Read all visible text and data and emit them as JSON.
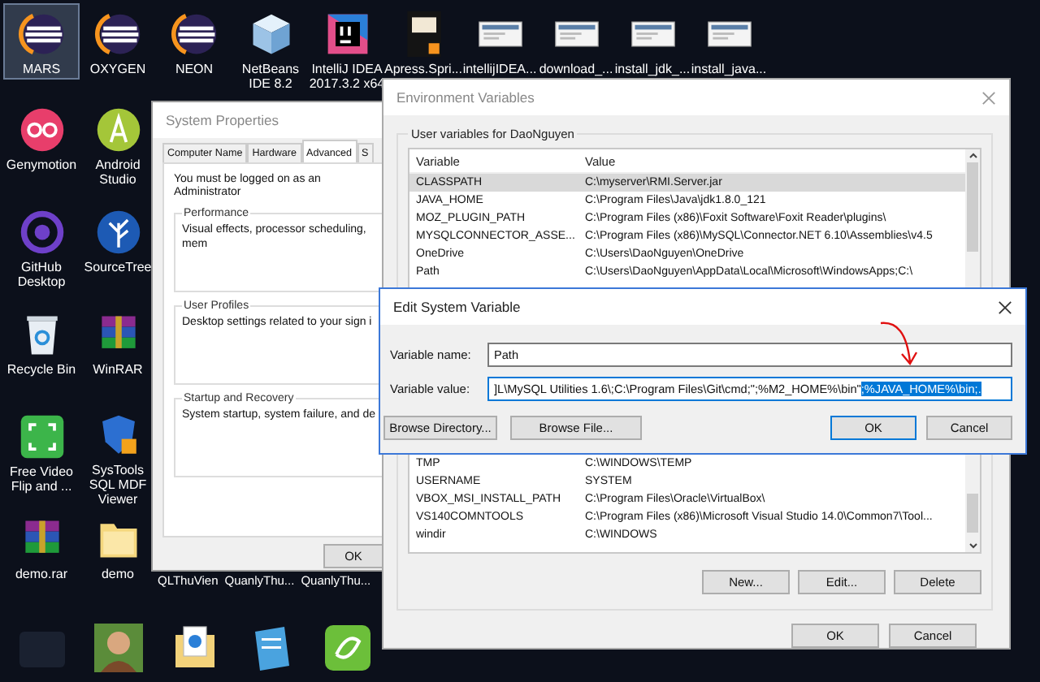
{
  "desktop": {
    "top_row": [
      {
        "label": "MARS",
        "kind": "eclipse",
        "selected": true
      },
      {
        "label": "OXYGEN",
        "kind": "eclipse",
        "selected": false
      },
      {
        "label": "NEON",
        "kind": "eclipse",
        "selected": false
      },
      {
        "label": "NetBeans IDE 8.2",
        "kind": "cube",
        "selected": false
      },
      {
        "label": "IntelliJ IDEA 2017.3.2 x64",
        "kind": "intellij",
        "selected": false
      },
      {
        "label": "Apress.Spri...",
        "kind": "book",
        "selected": false
      },
      {
        "label": "intellijIDEA...",
        "kind": "thumbnail",
        "selected": false
      },
      {
        "label": "download_...",
        "kind": "thumbnail",
        "selected": false
      },
      {
        "label": "install_jdk_...",
        "kind": "thumbnail",
        "selected": false
      },
      {
        "label": "install_java...",
        "kind": "thumbnail",
        "selected": false
      }
    ],
    "columns": [
      [
        {
          "label": "Genymotion",
          "kind": "genymotion",
          "selected": false
        },
        {
          "label": "GitHub Desktop",
          "kind": "github",
          "selected": false
        },
        {
          "label": "Recycle Bin",
          "kind": "recycle",
          "selected": false
        },
        {
          "label": "Free Video Flip and ...",
          "kind": "video",
          "selected": false
        },
        {
          "label": "demo.rar",
          "kind": "archive",
          "selected": false
        }
      ],
      [
        {
          "label": "Android Studio",
          "kind": "android",
          "selected": false
        },
        {
          "label": "SourceTree",
          "kind": "sourcetree",
          "selected": false
        },
        {
          "label": "WinRAR",
          "kind": "archive",
          "selected": false
        },
        {
          "label": "SysTools SQL MDF Viewer",
          "kind": "shield",
          "selected": false
        },
        {
          "label": "demo",
          "kind": "folder",
          "selected": false
        }
      ]
    ],
    "covered_labels": [
      "QLThuVien",
      "QuanlyThu...",
      "QuanlyThu..."
    ],
    "bottom_row": [
      {
        "kind": "dark"
      },
      {
        "kind": "avatar"
      },
      {
        "kind": "document"
      },
      {
        "kind": "notepad"
      },
      {
        "kind": "green"
      }
    ]
  },
  "system_properties": {
    "title": "System Properties",
    "tabs": [
      {
        "label": "Computer Name",
        "selected": false
      },
      {
        "label": "Hardware",
        "selected": false
      },
      {
        "label": "Advanced",
        "selected": true
      },
      {
        "label": "S",
        "selected": false
      }
    ],
    "notice": "You must be logged on as an Administrator",
    "groups": [
      {
        "title": "Performance",
        "text": "Visual effects, processor scheduling, mem"
      },
      {
        "title": "User Profiles",
        "text": "Desktop settings related to your sign i"
      },
      {
        "title": "Startup and Recovery",
        "text": "System startup, system failure, and de"
      }
    ],
    "ok_button": "OK"
  },
  "environment_variables": {
    "title": "Environment Variables",
    "group_title": "User variables for DaoNguyen",
    "columns": [
      "Variable",
      "Value"
    ],
    "user_rows": [
      {
        "variable": "CLASSPATH",
        "value": "C:\\myserver\\RMI.Server.jar",
        "selected": true
      },
      {
        "variable": "JAVA_HOME",
        "value": "C:\\Program Files\\Java\\jdk1.8.0_121",
        "selected": false
      },
      {
        "variable": "MOZ_PLUGIN_PATH",
        "value": "C:\\Program Files (x86)\\Foxit Software\\Foxit Reader\\plugins\\",
        "selected": false
      },
      {
        "variable": "MYSQLCONNECTOR_ASSE...",
        "value": "C:\\Program Files (x86)\\MySQL\\Connector.NET 6.10\\Assemblies\\v4.5",
        "selected": false
      },
      {
        "variable": "OneDrive",
        "value": "C:\\Users\\DaoNguyen\\OneDrive",
        "selected": false
      },
      {
        "variable": "Path",
        "value": "C:\\Users\\DaoNguyen\\AppData\\Local\\Microsoft\\WindowsApps;C:\\",
        "selected": false
      }
    ],
    "system_rows": [
      {
        "variable": "TMP",
        "value": "C:\\WINDOWS\\TEMP",
        "selected": false
      },
      {
        "variable": "USERNAME",
        "value": "SYSTEM",
        "selected": false
      },
      {
        "variable": "VBOX_MSI_INSTALL_PATH",
        "value": "C:\\Program Files\\Oracle\\VirtualBox\\",
        "selected": false
      },
      {
        "variable": "VS140COMNTOOLS",
        "value": "C:\\Program Files (x86)\\Microsoft Visual Studio 14.0\\Common7\\Tool...",
        "selected": false
      },
      {
        "variable": "windir",
        "value": "C:\\WINDOWS",
        "selected": false
      }
    ],
    "buttons": [
      "New...",
      "Edit...",
      "Delete"
    ],
    "footer_buttons": [
      "OK",
      "Cancel"
    ]
  },
  "edit_dialog": {
    "title": "Edit System Variable",
    "name_label": "Variable name:",
    "name_value": "Path",
    "value_label": "Variable value:",
    "value_text": "]L\\MySQL Utilities 1.6\\;C:\\Program Files\\Git\\cmd;\";%M2_HOME%\\bin\"",
    "value_selected": ";%JAVA_HOME%\\bin;.",
    "buttons": [
      {
        "label": "Browse Directory...",
        "default": false
      },
      {
        "label": "Browse File...",
        "default": false
      },
      {
        "label": "OK",
        "default": true
      },
      {
        "label": "Cancel",
        "default": false
      }
    ]
  }
}
